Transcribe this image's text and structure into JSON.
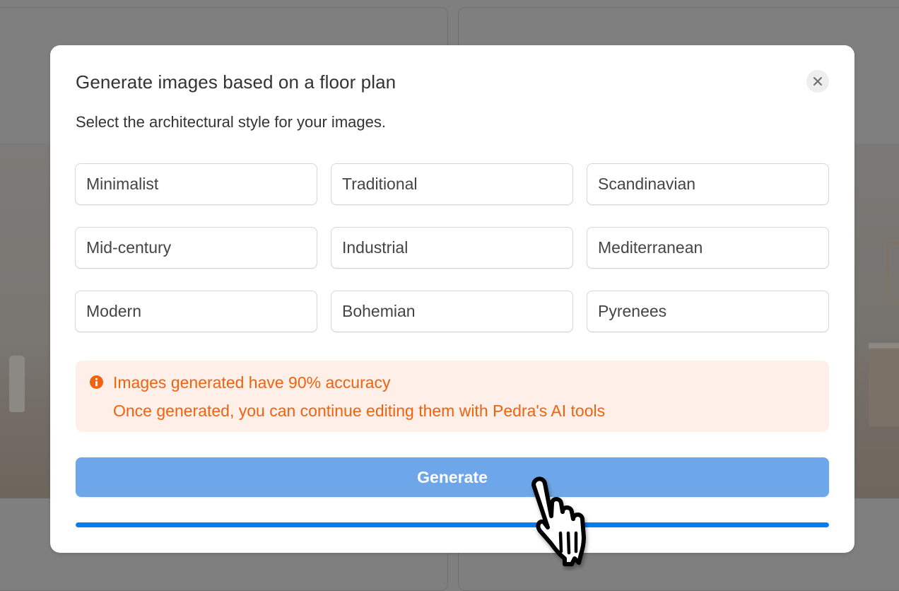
{
  "modal": {
    "title": "Generate images based on a floor plan",
    "subtitle": "Select the architectural style for your images.",
    "close_icon": "close-icon",
    "styles": [
      {
        "label": "Minimalist"
      },
      {
        "label": "Traditional"
      },
      {
        "label": "Scandinavian"
      },
      {
        "label": "Mid-century"
      },
      {
        "label": "Industrial"
      },
      {
        "label": "Mediterranean"
      },
      {
        "label": "Modern"
      },
      {
        "label": "Bohemian"
      },
      {
        "label": "Pyrenees"
      }
    ],
    "alert": {
      "icon": "info-icon",
      "title": "Images generated have 90% accuracy",
      "body": "Once generated, you can continue editing them with Pedra's AI tools",
      "color": "#f0620f",
      "background": "#fef0e9"
    },
    "generate_label": "Generate",
    "generate_color": "#6da7e9",
    "progress": {
      "percent": 100,
      "color": "#0a7bf2"
    }
  },
  "cursor": {
    "icon": "hand-pointer-icon"
  }
}
